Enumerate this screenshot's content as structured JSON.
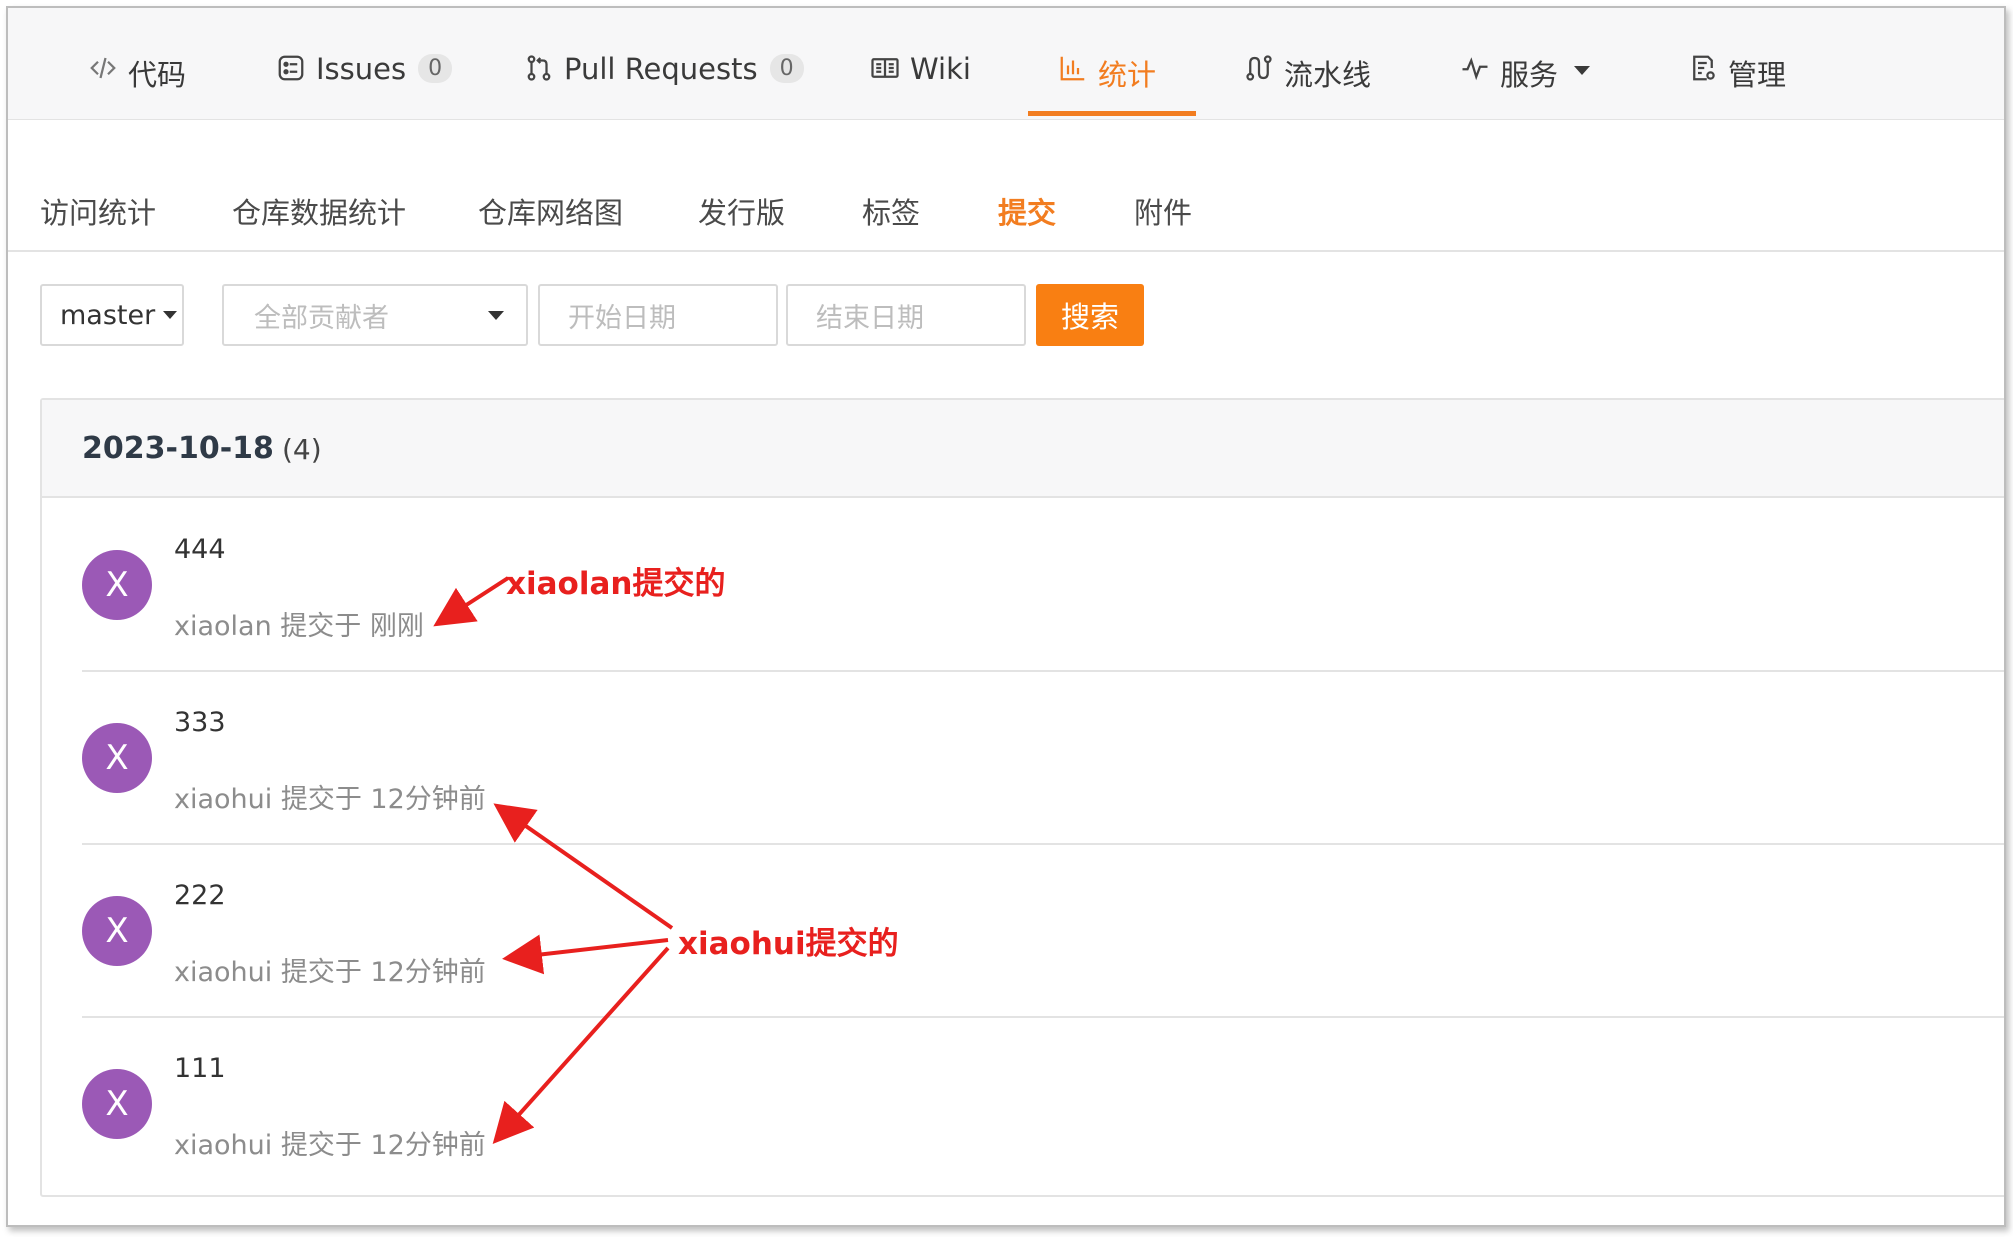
{
  "top_tabs": [
    {
      "name": "code",
      "label": "代码",
      "icon": "code-icon"
    },
    {
      "name": "issues",
      "label": "Issues",
      "badge": "0",
      "icon": "issue-icon"
    },
    {
      "name": "pull-requests",
      "label": "Pull Requests",
      "badge": "0",
      "icon": "pull-request-icon"
    },
    {
      "name": "wiki",
      "label": "Wiki",
      "icon": "book-icon"
    },
    {
      "name": "stats",
      "label": "统计",
      "icon": "bar-chart-icon",
      "active": true
    },
    {
      "name": "pipeline",
      "label": "流水线",
      "icon": "pipeline-icon"
    },
    {
      "name": "services",
      "label": "服务",
      "icon": "pulse-icon"
    },
    {
      "name": "manage",
      "label": "管理",
      "icon": "settings-doc-icon"
    }
  ],
  "sub_tabs": [
    {
      "label": "访问统计"
    },
    {
      "label": "仓库数据统计"
    },
    {
      "label": "仓库网络图"
    },
    {
      "label": "发行版"
    },
    {
      "label": "标签"
    },
    {
      "label": "提交",
      "active": true
    },
    {
      "label": "附件"
    }
  ],
  "filters": {
    "branch": "master",
    "contributor_placeholder": "全部贡献者",
    "start_date_placeholder": "开始日期",
    "end_date_placeholder": "结束日期",
    "search_label": "搜索"
  },
  "commit_group": {
    "date": "2023-10-18",
    "count": "(4)",
    "commits": [
      {
        "avatar": "X",
        "message": "444",
        "author_line": "xiaolan 提交于 刚刚"
      },
      {
        "avatar": "X",
        "message": "333",
        "author_line": "xiaohui 提交于 12分钟前"
      },
      {
        "avatar": "X",
        "message": "222",
        "author_line": "xiaohui 提交于 12分钟前"
      },
      {
        "avatar": "X",
        "message": "111",
        "author_line": "xiaohui 提交于 12分钟前"
      }
    ]
  },
  "annotations": {
    "xiaolan_note": "xiaolan提交的",
    "xiaohui_note": "xiaohui提交的"
  },
  "colors": {
    "accent": "#f27d20",
    "button": "#f97f12",
    "avatar": "#9b59b6",
    "annotation": "#e8201e"
  }
}
